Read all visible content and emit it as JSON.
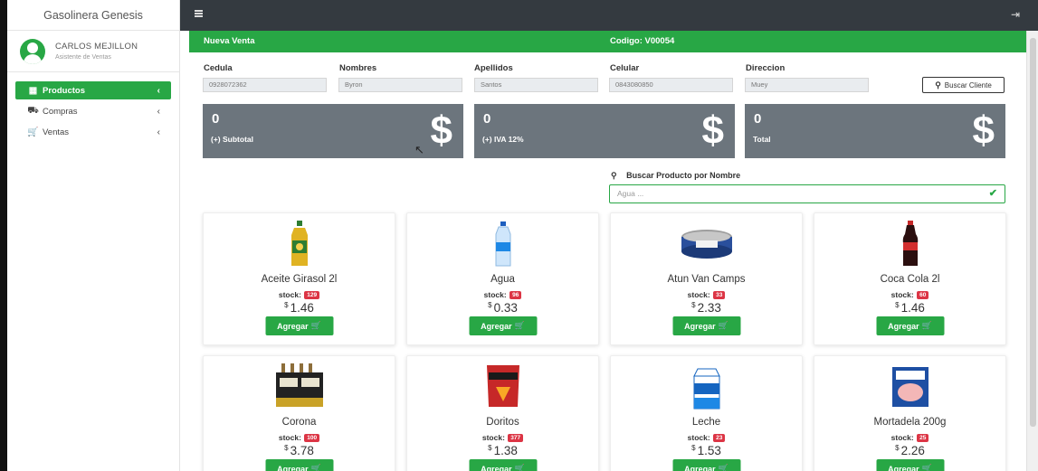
{
  "sidebar": {
    "brand": "Gasolinera Genesis",
    "user_name": "CARLOS MEJILLON",
    "user_role": "Asistente de Ventas",
    "items": [
      {
        "label": "Productos",
        "icon": "products-icon"
      },
      {
        "label": "Compras",
        "icon": "truck-icon"
      },
      {
        "label": "Ventas",
        "icon": "cart-icon"
      }
    ]
  },
  "header": {
    "title": "Nueva Venta",
    "code": "Codigo: V00054"
  },
  "client": {
    "cedula_label": "Cedula",
    "cedula": "0928072362",
    "nombres_label": "Nombres",
    "nombres": "Byron",
    "apellidos_label": "Apellidos",
    "apellidos": "Santos",
    "celular_label": "Celular",
    "celular": "0843080850",
    "direccion_label": "Direccion",
    "direccion": "Muey",
    "search_button": "Buscar Cliente"
  },
  "totals": {
    "subtotal_value": "0",
    "subtotal_label": "(+) Subtotal",
    "iva_value": "0",
    "iva_label": "(+) IVA 12%",
    "total_value": "0",
    "total_label": "Total",
    "dollar_symbol": "$"
  },
  "product_search": {
    "label": "Buscar Producto por Nombre",
    "placeholder": "Agua ..."
  },
  "products": [
    {
      "name": "Aceite Girasol 2l",
      "stock": "129",
      "price": "1.46"
    },
    {
      "name": "Agua",
      "stock": "96",
      "price": "0.33"
    },
    {
      "name": "Atun Van Camps",
      "stock": "33",
      "price": "2.33"
    },
    {
      "name": "Coca Cola 2l",
      "stock": "60",
      "price": "1.46"
    },
    {
      "name": "Corona",
      "stock": "100",
      "price": "3.78"
    },
    {
      "name": "Doritos",
      "stock": "377",
      "price": "1.38"
    },
    {
      "name": "Leche",
      "stock": "23",
      "price": "1.53"
    },
    {
      "name": "Mortadela 200g",
      "stock": "25",
      "price": "2.26"
    }
  ],
  "labels": {
    "stock": "stock:",
    "currency": "$",
    "add_button": "Agregar"
  },
  "colors": {
    "accent": "#28a745",
    "topbar": "#343a40",
    "stat_box": "#6c757d",
    "badge": "#dc3545"
  }
}
